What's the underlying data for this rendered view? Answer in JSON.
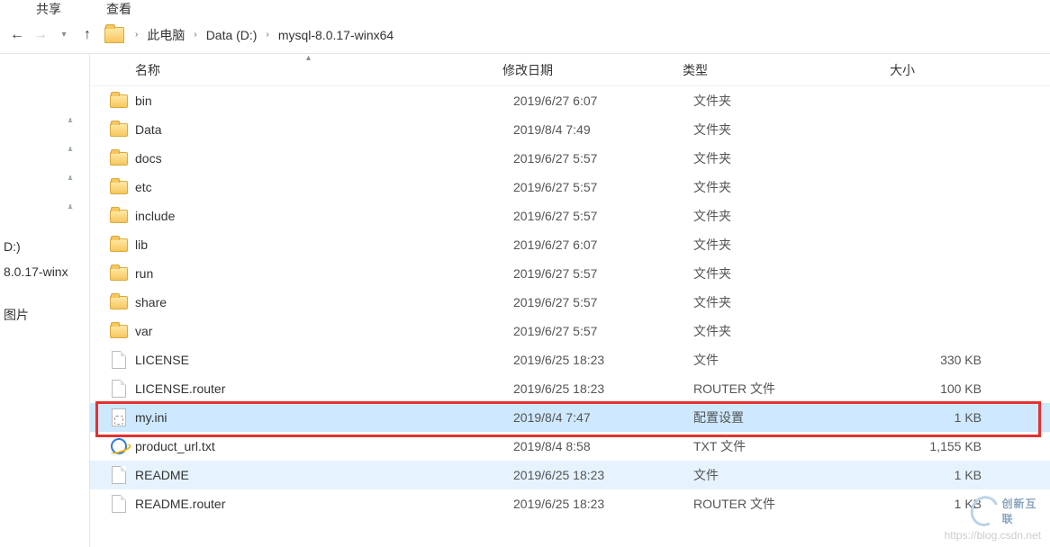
{
  "menubar": {
    "share": "共享",
    "view": "查看"
  },
  "breadcrumb": {
    "sep": "›",
    "pc": "此电脑",
    "drive": "Data (D:)",
    "folder": "mysql-8.0.17-winx64"
  },
  "columns": {
    "name": "名称",
    "date": "修改日期",
    "type": "类型",
    "size": "大小"
  },
  "sidebar": {
    "drive": "D:)",
    "folder": "8.0.17-winx",
    "pics": "图片"
  },
  "rows": [
    {
      "icon": "folder",
      "name": "bin",
      "date": "2019/6/27 6:07",
      "type": "文件夹",
      "size": ""
    },
    {
      "icon": "folder",
      "name": "Data",
      "date": "2019/8/4 7:49",
      "type": "文件夹",
      "size": ""
    },
    {
      "icon": "folder",
      "name": "docs",
      "date": "2019/6/27 5:57",
      "type": "文件夹",
      "size": ""
    },
    {
      "icon": "folder",
      "name": "etc",
      "date": "2019/6/27 5:57",
      "type": "文件夹",
      "size": ""
    },
    {
      "icon": "folder",
      "name": "include",
      "date": "2019/6/27 5:57",
      "type": "文件夹",
      "size": ""
    },
    {
      "icon": "folder",
      "name": "lib",
      "date": "2019/6/27 6:07",
      "type": "文件夹",
      "size": ""
    },
    {
      "icon": "folder",
      "name": "run",
      "date": "2019/6/27 5:57",
      "type": "文件夹",
      "size": ""
    },
    {
      "icon": "folder",
      "name": "share",
      "date": "2019/6/27 5:57",
      "type": "文件夹",
      "size": ""
    },
    {
      "icon": "folder",
      "name": "var",
      "date": "2019/6/27 5:57",
      "type": "文件夹",
      "size": ""
    },
    {
      "icon": "file",
      "name": "LICENSE",
      "date": "2019/6/25 18:23",
      "type": "文件",
      "size": "330 KB"
    },
    {
      "icon": "file",
      "name": "LICENSE.router",
      "date": "2019/6/25 18:23",
      "type": "ROUTER 文件",
      "size": "100 KB"
    },
    {
      "icon": "ini",
      "name": "my.ini",
      "date": "2019/8/4 7:47",
      "type": "配置设置",
      "size": "1 KB",
      "selected": true
    },
    {
      "icon": "ie",
      "name": "product_url.txt",
      "date": "2019/8/4 8:58",
      "type": "TXT 文件",
      "size": "1,155 KB"
    },
    {
      "icon": "file",
      "name": "README",
      "date": "2019/6/25 18:23",
      "type": "文件",
      "size": "1 KB",
      "hover": true
    },
    {
      "icon": "file",
      "name": "README.router",
      "date": "2019/6/25 18:23",
      "type": "ROUTER 文件",
      "size": "1 KB"
    }
  ],
  "watermark": "https://blog.csdn.net",
  "logo": "创新互联"
}
